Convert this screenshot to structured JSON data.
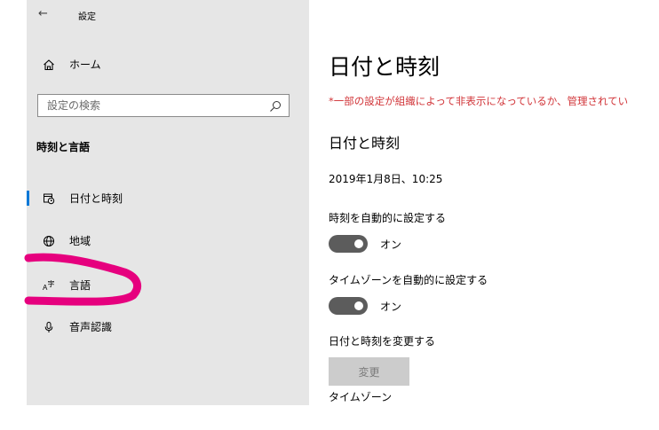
{
  "window": {
    "back_icon": "back-arrow-icon",
    "title": "設定"
  },
  "sidebar": {
    "home": {
      "label": "ホーム",
      "icon": "home-icon"
    },
    "search": {
      "placeholder": "設定の検索",
      "icon": "search-icon"
    },
    "section_header": "時刻と言語",
    "items": [
      {
        "label": "日付と時刻",
        "icon": "calendar-clock-icon",
        "active": true
      },
      {
        "label": "地域",
        "icon": "globe-icon"
      },
      {
        "label": "言語",
        "icon": "language-icon"
      },
      {
        "label": "音声認識",
        "icon": "microphone-icon"
      }
    ]
  },
  "content": {
    "page_title": "日付と時刻",
    "warning": "*一部の設定が組織によって非表示になっているか、管理されてい",
    "section_title": "日付と時刻",
    "current_datetime": "2019年1月8日、10:25",
    "auto_time": {
      "label": "時刻を自動的に設定する",
      "state_label": "オン",
      "on": true
    },
    "auto_timezone": {
      "label": "タイムゾーンを自動的に設定する",
      "state_label": "オン",
      "on": true
    },
    "change_datetime": {
      "label": "日付と時刻を変更する",
      "button_label": "変更"
    },
    "timezone": {
      "label": "タイムゾーン"
    }
  },
  "colors": {
    "sidebar_bg": "#e6e6e6",
    "warning": "#d13438",
    "toggle_on": "#5c5c5c",
    "annotation": "#e6007e",
    "disabled_button": "#cccccc"
  }
}
